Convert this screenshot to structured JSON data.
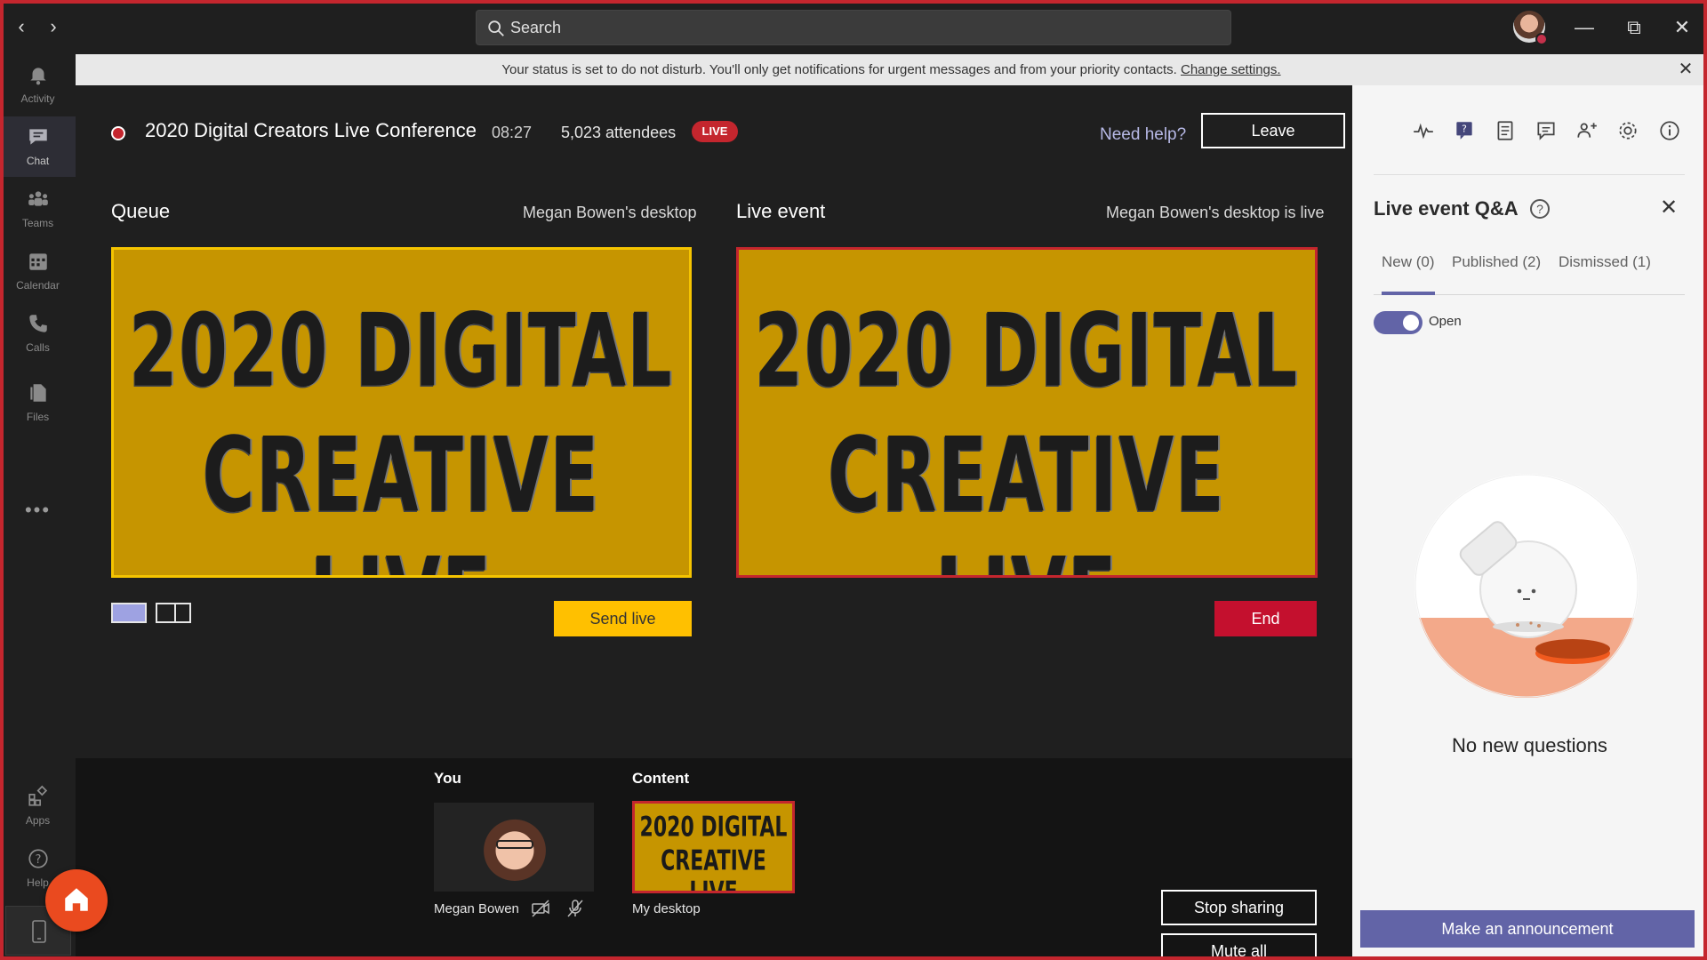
{
  "titlebar": {
    "back_icon": "chevron-left-icon",
    "forward_icon": "chevron-right-icon",
    "search_placeholder": "Search",
    "window_controls": [
      "minimize-icon",
      "restore-icon",
      "close-icon"
    ],
    "status": "do-not-disturb"
  },
  "rail": {
    "items": [
      {
        "label": "Activity",
        "icon": "bell-icon"
      },
      {
        "label": "Chat",
        "icon": "chat-icon"
      },
      {
        "label": "Teams",
        "icon": "teams-icon"
      },
      {
        "label": "Calendar",
        "icon": "calendar-icon"
      },
      {
        "label": "Calls",
        "icon": "phone-icon"
      },
      {
        "label": "Files",
        "icon": "files-icon"
      },
      {
        "label": "Apps",
        "icon": "apps-icon"
      },
      {
        "label": "Help",
        "icon": "help-icon"
      }
    ],
    "more": "•••",
    "active": "Chat"
  },
  "banner": {
    "text": "Your status is set to do not disturb. You'll only get notifications for urgent messages and from your priority contacts.",
    "link": "Change settings."
  },
  "event": {
    "title": "2020 Digital Creators Live Conference",
    "time": "08:27",
    "attendees": "5,023 attendees",
    "live_badge": "LIVE",
    "need_help": "Need help?",
    "leave": "Leave"
  },
  "queue": {
    "title": "Queue",
    "source": "Megan Bowen's desktop",
    "send_live": "Send live"
  },
  "live_event": {
    "title": "Live event",
    "source": "Megan Bowen's desktop is live",
    "end": "End"
  },
  "slide": {
    "line1": "2020 DIGITAL",
    "line2": "CREATIVE LIVE",
    "background": "#c69500"
  },
  "bottom": {
    "you_label": "You",
    "you_name": "Megan Bowen",
    "content_label": "Content",
    "content_name": "My desktop",
    "stop_sharing": "Stop sharing",
    "mute_all": "Mute all"
  },
  "panel": {
    "title": "Live event Q&A",
    "tabs": [
      "New (0)",
      "Published (2)",
      "Dismissed (1)"
    ],
    "active_tab": "New (0)",
    "toggle_label": "Open",
    "toggle_on": true,
    "empty_text": "No new questions",
    "announce": "Make an announcement",
    "toolbar_icons": [
      "health-icon",
      "qa-icon",
      "notes-icon",
      "chat-icon",
      "people-icon",
      "settings-icon",
      "info-icon"
    ]
  },
  "colors": {
    "accent": "#6264a7",
    "live_red": "#c4262e",
    "send_yellow": "#ffc000",
    "end_red": "#c4102e"
  }
}
